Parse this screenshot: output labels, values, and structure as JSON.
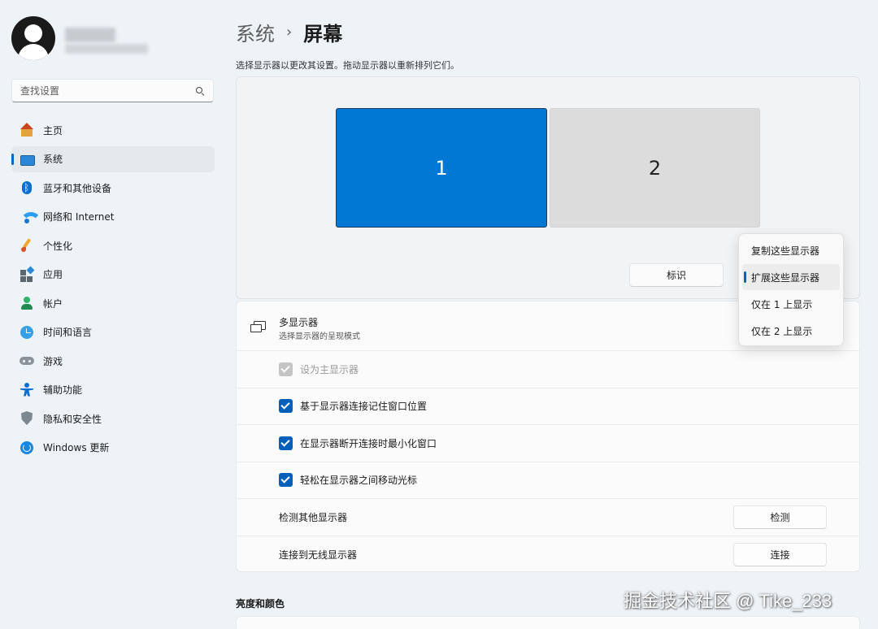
{
  "sidebar": {
    "search_placeholder": "查找设置",
    "items": [
      {
        "label": "主页",
        "icon": "home-icon"
      },
      {
        "label": "系统",
        "icon": "system-icon",
        "active": true
      },
      {
        "label": "蓝牙和其他设备",
        "icon": "bluetooth-icon"
      },
      {
        "label": "网络和 Internet",
        "icon": "wifi-icon"
      },
      {
        "label": "个性化",
        "icon": "brush-icon"
      },
      {
        "label": "应用",
        "icon": "apps-icon"
      },
      {
        "label": "帐户",
        "icon": "account-icon"
      },
      {
        "label": "时间和语言",
        "icon": "time-language-icon"
      },
      {
        "label": "游戏",
        "icon": "gaming-icon"
      },
      {
        "label": "辅助功能",
        "icon": "accessibility-icon"
      },
      {
        "label": "隐私和安全性",
        "icon": "shield-icon"
      },
      {
        "label": "Windows 更新",
        "icon": "update-icon"
      }
    ]
  },
  "breadcrumb": {
    "parent": "系统",
    "separator": "›",
    "current": "屏幕"
  },
  "description": "选择显示器以更改其设置。拖动显示器以重新排列它们。",
  "arrangement": {
    "monitors": [
      {
        "label": "1",
        "selected": true
      },
      {
        "label": "2",
        "selected": false
      }
    ],
    "identify_label": "标识"
  },
  "multi_display": {
    "title": "多显示器",
    "subtitle": "选择显示器的呈现模式",
    "checkboxes": [
      {
        "label": "设为主显示器",
        "checked": true,
        "disabled": true
      },
      {
        "label": "基于显示器连接记住窗口位置",
        "checked": true,
        "disabled": false
      },
      {
        "label": "在显示器断开连接时最小化窗口",
        "checked": true,
        "disabled": false
      },
      {
        "label": "轻松在显示器之间移动光标",
        "checked": true,
        "disabled": false
      }
    ],
    "actions": [
      {
        "label": "检测其他显示器",
        "button": "检测"
      },
      {
        "label": "连接到无线显示器",
        "button": "连接"
      }
    ]
  },
  "dropdown": {
    "options": [
      "复制这些显示器",
      "扩展这些显示器",
      "仅在 1 上显示",
      "仅在 2 上显示"
    ],
    "selected": "扩展这些显示器"
  },
  "section_brightness": "亮度和颜色",
  "watermark": "掘金技术社区 @ Tike_233",
  "colors": {
    "accent": "#0078d4",
    "accent_dark": "#005fb8",
    "background": "#eef3f7"
  }
}
